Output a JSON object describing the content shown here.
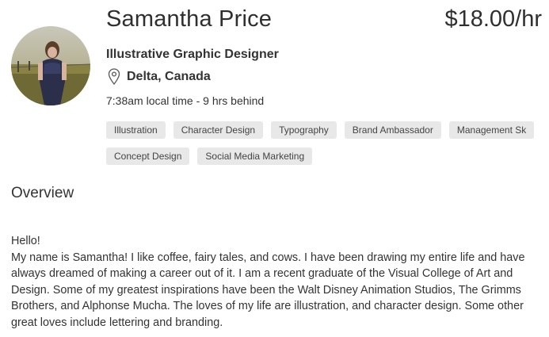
{
  "profile": {
    "name": "Samantha Price",
    "rate": "$18.00/hr",
    "title": "Illustrative Graphic Designer",
    "location": "Delta, Canada",
    "local_time": "7:38am local time - 9 hrs behind",
    "location_icon": "map-pin-icon",
    "avatar_alt": "profile photo"
  },
  "skills": {
    "row1": [
      "Illustration",
      "Character Design",
      "Typography",
      "Brand Ambassador",
      "Management Sk"
    ],
    "row2": [
      "Concept Design",
      "Social Media Marketing"
    ]
  },
  "overview": {
    "heading": "Overview",
    "body": "Hello!\nMy name is Samantha! I like coffee, fairy tales, and cows. I have been drawing my entire life and have always dreamed of making a career out of it. I am a recent graduate of the Visual College of Art and Design. Some of my greatest inspirations have been the Walt Disney Animation Studios, The Grimms Brothers, and Alphonse Mucha. The loves of my life are illustration, and character design. Some other great loves include lettering and branding."
  },
  "colors": {
    "tag_bg": "#e8e8e8",
    "text": "#333333"
  }
}
